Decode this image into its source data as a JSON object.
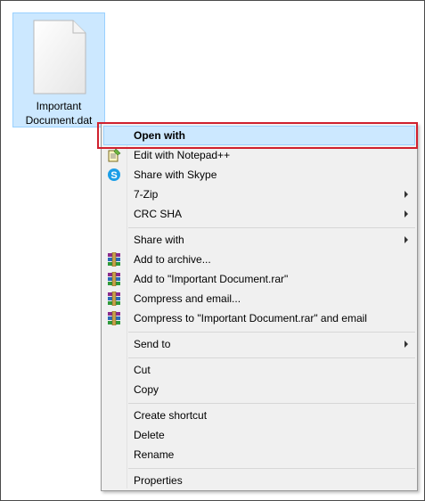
{
  "desktop_file": {
    "name_line1": "Important",
    "name_line2": "Document.dat"
  },
  "context_menu": {
    "items": [
      {
        "label": "Open with",
        "bold": true,
        "highlighted": true
      },
      {
        "label": "Edit with Notepad++",
        "icon": "notepad-plus-icon"
      },
      {
        "label": "Share with Skype",
        "icon": "skype-icon"
      },
      {
        "label": "7-Zip",
        "submenu": true
      },
      {
        "label": "CRC SHA",
        "submenu": true
      },
      {
        "label": "Share with",
        "submenu": true
      },
      {
        "label": "Add to archive...",
        "icon": "winrar-icon"
      },
      {
        "label": "Add to \"Important Document.rar\"",
        "icon": "winrar-icon"
      },
      {
        "label": "Compress and email...",
        "icon": "winrar-icon"
      },
      {
        "label": "Compress to \"Important Document.rar\" and email",
        "icon": "winrar-icon"
      },
      {
        "label": "Send to",
        "submenu": true
      },
      {
        "label": "Cut"
      },
      {
        "label": "Copy"
      },
      {
        "label": "Create shortcut"
      },
      {
        "label": "Delete"
      },
      {
        "label": "Rename"
      },
      {
        "label": "Properties"
      }
    ]
  },
  "colors": {
    "highlight_fill": "#cce8ff",
    "highlight_border": "#99d1ff",
    "annotation_outline": "#d0202e",
    "menu_background": "#f0f0f0"
  }
}
